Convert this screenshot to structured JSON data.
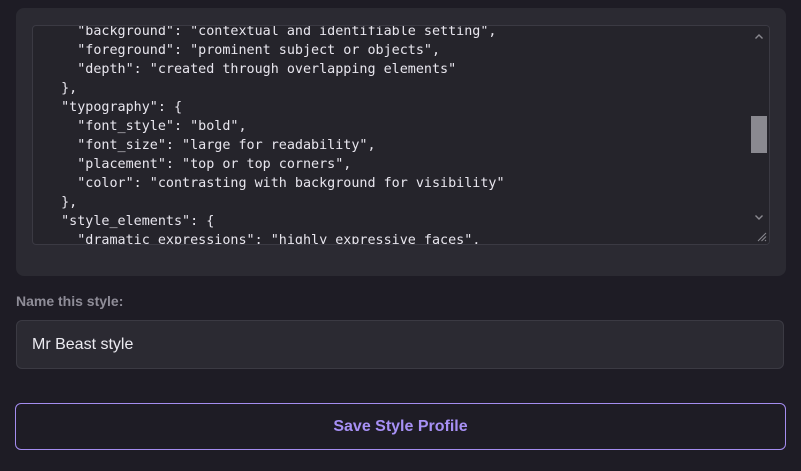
{
  "style_json": {
    "lines": [
      "    \"background\": \"contextual and identifiable setting\",",
      "    \"foreground\": \"prominent subject or objects\",",
      "    \"depth\": \"created through overlapping elements\"",
      "  },",
      "  \"typography\": {",
      "    \"font_style\": \"bold\",",
      "    \"font_size\": \"large for readability\",",
      "    \"placement\": \"top or top corners\",",
      "    \"color\": \"contrasting with background for visibility\"",
      "  },",
      "  \"style_elements\": {",
      "    \"dramatic_expressions\": \"highly expressive faces\","
    ]
  },
  "name_field": {
    "label": "Name this style:",
    "value": "Mr Beast style"
  },
  "save_button": {
    "label": "Save Style Profile"
  },
  "icons": {
    "scroll_up": "chevron-up-icon",
    "scroll_down": "chevron-down-icon",
    "resize": "resize-grip-icon"
  },
  "colors": {
    "page_background": "#1e1c25",
    "panel_background": "#2b2a32",
    "code_background": "#25242b",
    "accent": "#a790f5",
    "label_text": "#8f8d98"
  }
}
